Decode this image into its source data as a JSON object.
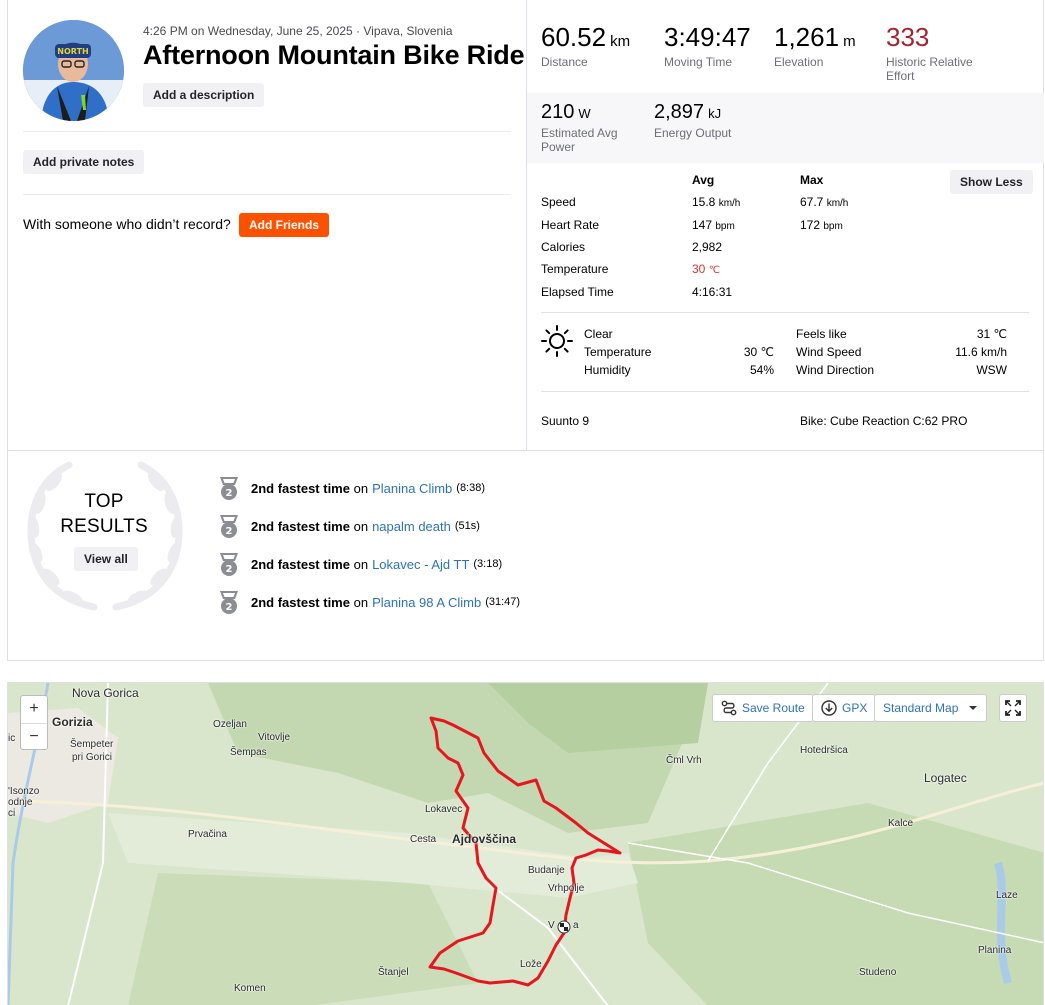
{
  "activity": {
    "meta": "4:26 PM on Wednesday, June 25, 2025 · Vipava, Slovenia",
    "title": "Afternoon Mountain Bike Ride",
    "add_description": "Add a description",
    "add_private_notes": "Add private notes",
    "with_someone": "With someone who didn’t record?",
    "add_friends": "Add Friends"
  },
  "stats": {
    "distance": {
      "value": "60.52",
      "unit": "km",
      "label": "Distance"
    },
    "moving_time": {
      "value": "3:49:47",
      "label": "Moving Time"
    },
    "elevation": {
      "value": "1,261",
      "unit": "m",
      "label": "Elevation"
    },
    "relative_effort": {
      "value": "333",
      "label": "Historic Relative Effort"
    },
    "avg_power": {
      "value": "210",
      "unit": "W",
      "label": "Estimated Avg Power"
    },
    "energy": {
      "value": "2,897",
      "unit": "kJ",
      "label": "Energy Output"
    }
  },
  "details": {
    "avg_header": "Avg",
    "max_header": "Max",
    "show_less": "Show Less",
    "rows": [
      {
        "label": "Speed",
        "avg": "15.8",
        "avg_unit": "km/h",
        "max": "67.7",
        "max_unit": "km/h"
      },
      {
        "label": "Heart Rate",
        "avg": "147",
        "avg_unit": "bpm",
        "max": "172",
        "max_unit": "bpm"
      },
      {
        "label": "Calories",
        "avg": "2,982",
        "avg_unit": "",
        "max": "",
        "max_unit": ""
      },
      {
        "label": "Temperature",
        "avg": "30",
        "avg_unit": "℃",
        "max": "",
        "max_unit": ""
      },
      {
        "label": "Elapsed Time",
        "avg": "4:16:31",
        "avg_unit": "",
        "max": "",
        "max_unit": ""
      }
    ]
  },
  "weather": {
    "condition": "Clear",
    "temperature_label": "Temperature",
    "temperature": "30 ℃",
    "humidity_label": "Humidity",
    "humidity": "54%",
    "feels_like_label": "Feels like",
    "feels_like": "31 ℃",
    "wind_speed_label": "Wind Speed",
    "wind_speed": "11.6 km/h",
    "wind_direction_label": "Wind Direction",
    "wind_direction": "WSW"
  },
  "device": "Suunto 9",
  "bike": "Bike: Cube Reaction C:62 PRO",
  "top_results": {
    "heading_1": "TOP",
    "heading_2": "RESULTS",
    "view_all": "View all",
    "medal_rank": "2",
    "items": [
      {
        "rank_text": "2nd fastest time",
        "on": "on",
        "segment": "Planina Climb",
        "time": "(8:38)"
      },
      {
        "rank_text": "2nd fastest time",
        "on": "on",
        "segment": "napalm death",
        "time": "(51s)"
      },
      {
        "rank_text": "2nd fastest time",
        "on": "on",
        "segment": "Lokavec - Ajd TT",
        "time": "(3:18)"
      },
      {
        "rank_text": "2nd fastest time",
        "on": "on",
        "segment": "Planina 98 A Climb",
        "time": "(31:47)"
      }
    ]
  },
  "map": {
    "zoom_in": "+",
    "zoom_out": "−",
    "save_route": "Save Route",
    "gpx": "GPX",
    "map_type": "Standard Map",
    "places": {
      "nova_gorica": "Nova Gorica",
      "gorizia": "Gorizia",
      "sempeter": "Šempeter",
      "pri_gorici": "pri Gorici",
      "ozeljan": "Ozeljan",
      "vitovlje": "Vitovlje",
      "sempas": "Šempas",
      "isonzo_1": "'Isonzo",
      "isonzo_2": "odnje",
      "isonzo_3": "ci",
      "prvacina": "Prvačina",
      "lokavec": "Lokavec",
      "cesta": "Cesta",
      "ajdovscina": "Ajdovščina",
      "budanje": "Budanje",
      "vrhpolje": "Vrhpolje",
      "vipava_1": "V",
      "vipava_2": "a",
      "loze": "Lože",
      "stanjel": "Štanjel",
      "komen": "Komen",
      "cml_vrh": "Čml Vrh",
      "hotedrsica": "Hotedršica",
      "logatec": "Logatec",
      "kalce": "Kalce",
      "laze": "Laze",
      "planina": "Planina",
      "studeno": "Studeno",
      "sk": "ic",
      "zoom_edge": "ic"
    }
  },
  "colors": {
    "brand_orange": "#fc5200",
    "relative_effort_red": "#a3232f",
    "temperature_red": "#e0322d",
    "link_blue": "#2d73b4",
    "route_red": "#e6161e"
  }
}
